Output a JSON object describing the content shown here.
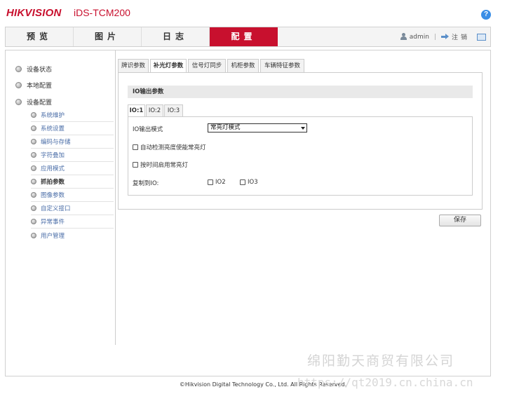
{
  "header": {
    "brand": "HIKVISION",
    "model": "iDS-TCM200",
    "help_glyph": "?"
  },
  "nav": {
    "tabs": [
      {
        "label": "预览"
      },
      {
        "label": "图片"
      },
      {
        "label": "日志"
      },
      {
        "label": "配置",
        "active": true
      }
    ],
    "user": "admin",
    "separator": "|",
    "logout": "注销"
  },
  "sidebar": {
    "top_items": [
      {
        "label": "设备状态"
      },
      {
        "label": "本地配置"
      },
      {
        "label": "设备配置"
      }
    ],
    "sub_items": [
      {
        "label": "系统维护"
      },
      {
        "label": "系统设置"
      },
      {
        "label": "编码与存储"
      },
      {
        "label": "字符叠加"
      },
      {
        "label": "应用模式"
      },
      {
        "label": "抓拍参数",
        "active": true
      },
      {
        "label": "图像参数"
      },
      {
        "label": "自定义接口"
      },
      {
        "label": "异常事件"
      },
      {
        "label": "用户管理"
      }
    ]
  },
  "tabs": [
    {
      "label": "牌识参数"
    },
    {
      "label": "补光灯参数",
      "active": true
    },
    {
      "label": "信号灯同步"
    },
    {
      "label": "机柜参数"
    },
    {
      "label": "车辆特征参数"
    }
  ],
  "section": {
    "title": "IO输出参数",
    "subtabs": [
      {
        "label": "IO:1",
        "active": true
      },
      {
        "label": "IO:2"
      },
      {
        "label": "IO:3"
      }
    ],
    "mode_label": "IO输出模式",
    "mode_value": "常亮灯模式",
    "cb_auto": "自动检测亮度使能常亮灯",
    "cb_timer": "按时间启用常亮灯",
    "copy_label": "复制到IO:",
    "copy_io2": "IO2",
    "copy_io3": "IO3"
  },
  "actions": {
    "save": "保存"
  },
  "footer": {
    "copyright": "©Hikvision Digital Technology Co., Ltd. All Rights Reserved."
  },
  "watermark": {
    "company": "绵阳勤天商贸有限公司",
    "url": "https://qt2019.cn.china.cn"
  }
}
